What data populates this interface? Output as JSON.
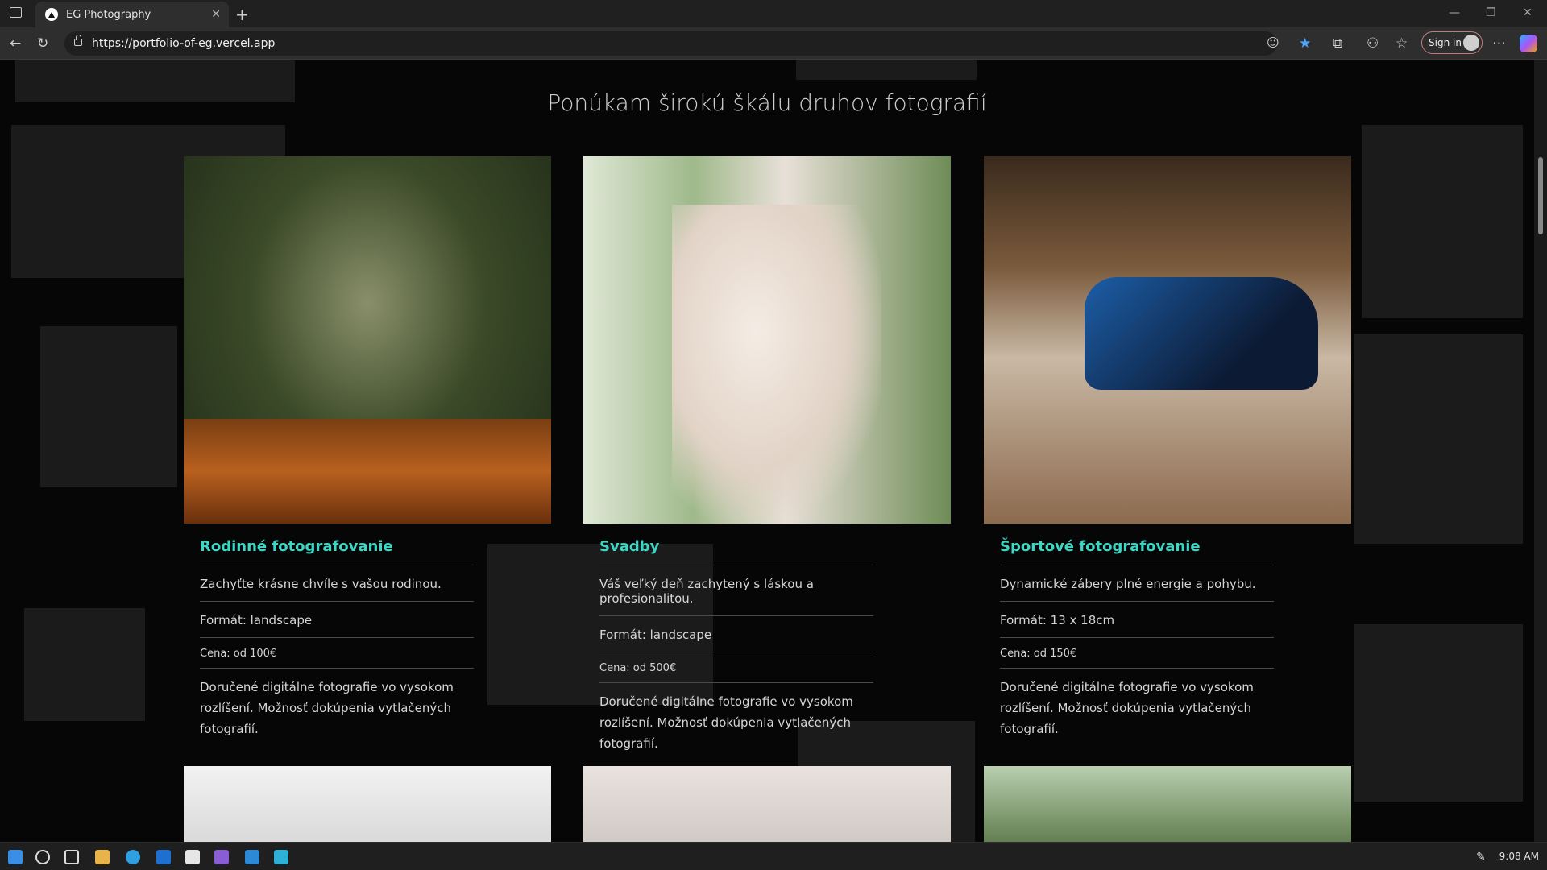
{
  "browser": {
    "tab_title": "EG Photography",
    "tab_close": "✕",
    "new_tab": "+",
    "url": "https://portfolio-of-eg.vercel.app",
    "sign_in": "Sign in",
    "window_controls": [
      "—",
      "❐",
      "✕"
    ],
    "icons": [
      "back-icon",
      "refresh-icon",
      "lock-icon",
      "reader-icon",
      "star-icon",
      "extensions-icon",
      "split-icon",
      "favorites-icon",
      "more-icon",
      "copilot-icon"
    ]
  },
  "page": {
    "heading": "Ponúkam širokú škálu druhov fotografií",
    "cards": [
      {
        "title": "Rodinné fotografovanie",
        "subtitle": "Zachyťte krásne chvíle s vašou rodinou.",
        "format": "Formát: landscape",
        "price": "Cena: od 100€",
        "description": "Doručené digitálne fotografie vo vysokom rozlíšení. Možnosť dokúpenia vytlačených fotografií."
      },
      {
        "title": "Svadby",
        "subtitle": "Váš veľký deň zachytený s láskou a profesionalitou.",
        "format": "Formát: landscape",
        "price": "Cena: od 500€",
        "description": "Doručené digitálne fotografie vo vysokom rozlíšení. Možnosť dokúpenia vytlačených fotografií."
      },
      {
        "title": "Športové fotografovanie",
        "subtitle": "Dynamické zábery plné energie a pohybu.",
        "format": "Formát: 13 x 18cm",
        "price": "Cena: od 150€",
        "description": "Doručené digitálne fotografie vo vysokom rozlíšení. Možnosť dokúpenia vytlačených fotografií."
      }
    ]
  },
  "taskbar": {
    "time": "9:08 AM",
    "colors": {
      "accent": "#3fd6c6",
      "background": "#060606"
    }
  }
}
